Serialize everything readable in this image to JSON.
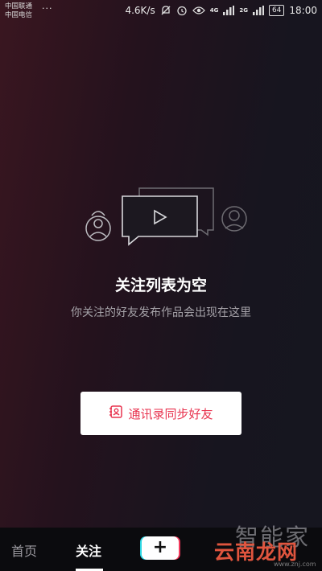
{
  "status_bar": {
    "carrier1": "中国联通",
    "carrier2": "中国电信",
    "more": "···",
    "speed": "4.6K/s",
    "net1": "4G",
    "net2": "2G",
    "battery": "64",
    "time": "18:00"
  },
  "empty_state": {
    "title": "关注列表为空",
    "subtitle": "你关注的好友发布作品会出现在这里"
  },
  "contacts_button": {
    "label": "通讯录同步好友"
  },
  "tabbar": {
    "home": "首页",
    "following": "关注",
    "plus": "+",
    "colors": {
      "cyan": "#2bd6e2",
      "red": "#f43a5c"
    }
  },
  "watermark": {
    "line1": "智能家",
    "line2": "云南龙网",
    "line3": "www.znj.com"
  },
  "accent_color": "#e8334f"
}
